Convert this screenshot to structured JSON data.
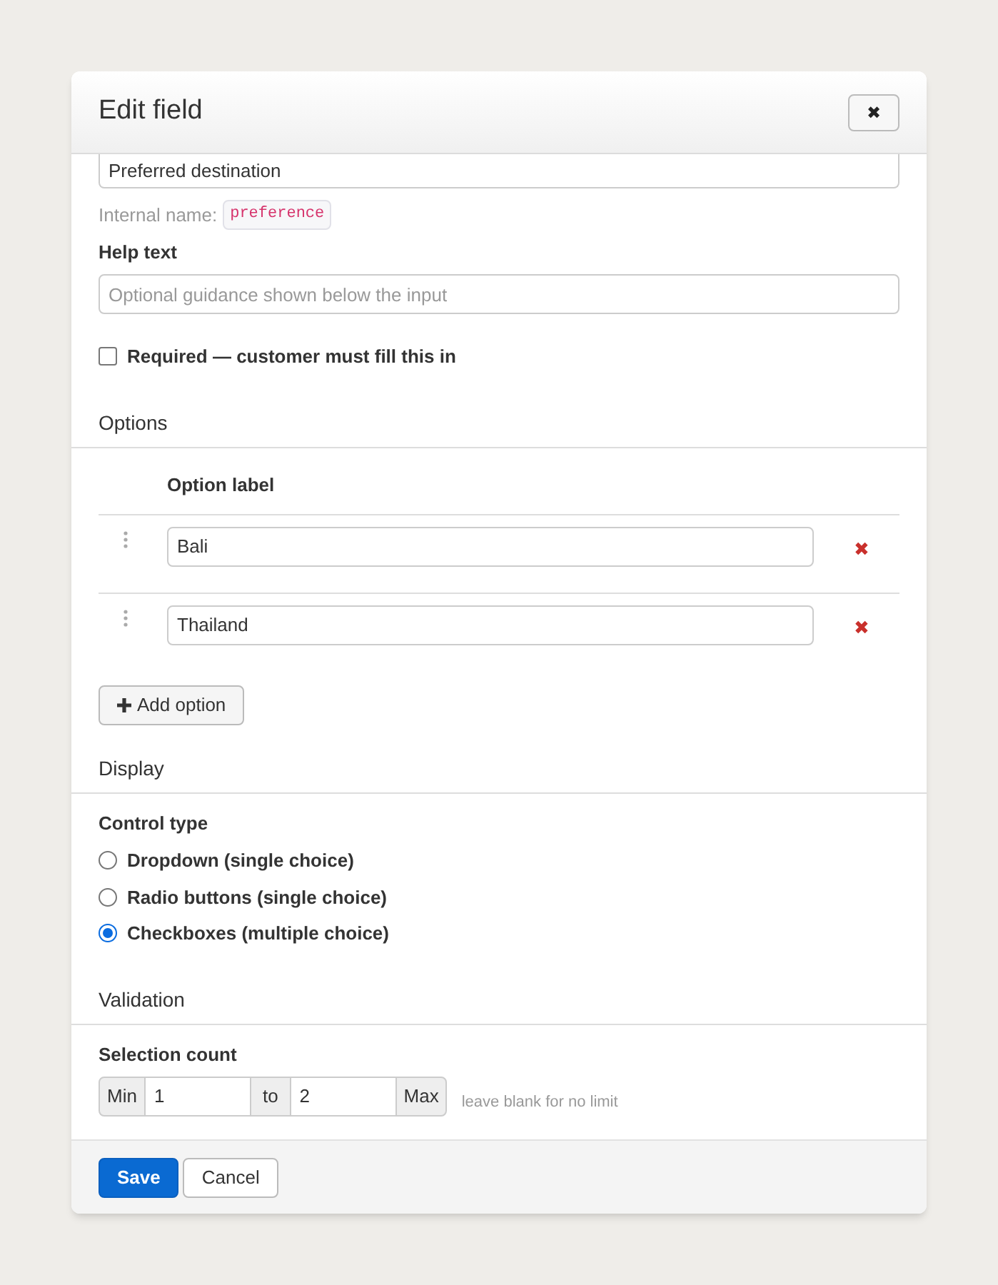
{
  "dialog": {
    "title": "Edit field",
    "close_label": "✖"
  },
  "label_field": {
    "value": "Preferred destination"
  },
  "internal_name": {
    "label": "Internal name:",
    "value": "preference"
  },
  "help_text": {
    "label": "Help text",
    "placeholder": "Optional guidance shown below the input"
  },
  "required": {
    "label": "Required — customer must fill this in",
    "checked": false
  },
  "options": {
    "heading": "Options",
    "column": "Option label",
    "rows": [
      {
        "value": "Bali",
        "remove": "✖"
      },
      {
        "value": "Thailand",
        "remove": "✖"
      }
    ],
    "add_button": "Add option"
  },
  "display": {
    "heading": "Display",
    "label": "Control type",
    "choices": [
      {
        "label": "Dropdown (single choice)",
        "selected": false
      },
      {
        "label": "Radio buttons (single choice)",
        "selected": false
      },
      {
        "label": "Checkboxes (multiple choice)",
        "selected": true
      }
    ]
  },
  "validation": {
    "heading": "Validation",
    "label": "Selection count",
    "min_addon": "Min",
    "min_value": "1",
    "between": "to",
    "max_value": "2",
    "max_addon": "Max",
    "hint": "leave blank for no limit"
  },
  "footer": {
    "buttons": [
      "Save",
      "Cancel"
    ]
  }
}
